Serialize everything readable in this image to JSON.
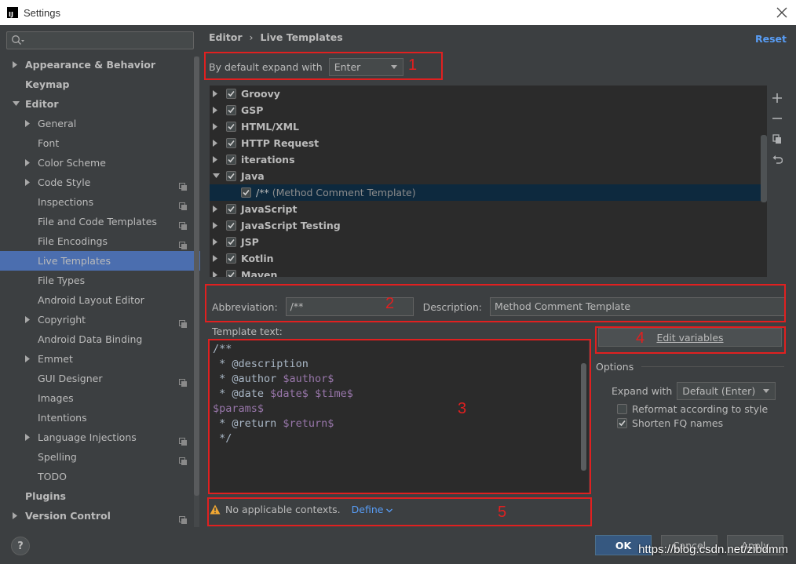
{
  "window": {
    "title": "Settings"
  },
  "search": {
    "placeholder": ""
  },
  "sidebar": {
    "items": [
      {
        "label": "Appearance & Behavior",
        "level": 0,
        "bold": true,
        "arrow": "right"
      },
      {
        "label": "Keymap",
        "level": 0,
        "bold": true
      },
      {
        "label": "Editor",
        "level": 0,
        "bold": true,
        "arrow": "down"
      },
      {
        "label": "General",
        "level": 1,
        "arrow": "right"
      },
      {
        "label": "Font",
        "level": 1
      },
      {
        "label": "Color Scheme",
        "level": 1,
        "arrow": "right"
      },
      {
        "label": "Code Style",
        "level": 1,
        "arrow": "right",
        "copy": true
      },
      {
        "label": "Inspections",
        "level": 1,
        "copy": true
      },
      {
        "label": "File and Code Templates",
        "level": 1,
        "copy": true
      },
      {
        "label": "File Encodings",
        "level": 1,
        "copy": true
      },
      {
        "label": "Live Templates",
        "level": 1,
        "selected": true
      },
      {
        "label": "File Types",
        "level": 1
      },
      {
        "label": "Android Layout Editor",
        "level": 1
      },
      {
        "label": "Copyright",
        "level": 1,
        "arrow": "right",
        "copy": true
      },
      {
        "label": "Android Data Binding",
        "level": 1
      },
      {
        "label": "Emmet",
        "level": 1,
        "arrow": "right"
      },
      {
        "label": "GUI Designer",
        "level": 1,
        "copy": true
      },
      {
        "label": "Images",
        "level": 1
      },
      {
        "label": "Intentions",
        "level": 1
      },
      {
        "label": "Language Injections",
        "level": 1,
        "arrow": "right",
        "copy": true
      },
      {
        "label": "Spelling",
        "level": 1,
        "copy": true
      },
      {
        "label": "TODO",
        "level": 1
      },
      {
        "label": "Plugins",
        "level": 0,
        "bold": true
      },
      {
        "label": "Version Control",
        "level": 0,
        "bold": true,
        "arrow": "right",
        "copy": true
      }
    ]
  },
  "breadcrumb": {
    "parent": "Editor",
    "separator": "›",
    "current": "Live Templates"
  },
  "reset_label": "Reset",
  "expand_default": {
    "label": "By default expand with",
    "value": "Enter"
  },
  "template_groups": [
    {
      "label": "Groovy",
      "checked": true,
      "arrow": "right"
    },
    {
      "label": "GSP",
      "checked": true,
      "arrow": "right"
    },
    {
      "label": "HTML/XML",
      "checked": true,
      "arrow": "right"
    },
    {
      "label": "HTTP Request",
      "checked": true,
      "arrow": "right"
    },
    {
      "label": "iterations",
      "checked": true,
      "arrow": "right"
    },
    {
      "label": "Java",
      "checked": true,
      "arrow": "down"
    },
    {
      "label": "/**",
      "desc": "(Method Comment Template)",
      "checked": true,
      "child": true,
      "selected": true
    },
    {
      "label": "JavaScript",
      "checked": true,
      "arrow": "right"
    },
    {
      "label": "JavaScript Testing",
      "checked": true,
      "arrow": "right"
    },
    {
      "label": "JSP",
      "checked": true,
      "arrow": "right"
    },
    {
      "label": "Kotlin",
      "checked": true,
      "arrow": "right"
    },
    {
      "label": "Maven",
      "checked": true,
      "arrow": "right"
    }
  ],
  "abbreviation": {
    "label": "Abbreviation:",
    "value": "/**"
  },
  "description": {
    "label": "Description:",
    "value": "Method Comment Template"
  },
  "template_text": {
    "label": "Template text:",
    "lines": [
      [
        {
          "t": "/**"
        }
      ],
      [
        {
          "t": " * @description"
        }
      ],
      [
        {
          "t": " * @author "
        },
        {
          "t": "$author$",
          "v": true
        }
      ],
      [
        {
          "t": " * @date "
        },
        {
          "t": "$date$",
          "v": true
        },
        {
          "t": " "
        },
        {
          "t": "$time$",
          "v": true
        }
      ],
      [
        {
          "t": "$params$",
          "v": true
        }
      ],
      [
        {
          "t": " * @return "
        },
        {
          "t": "$return$",
          "v": true
        }
      ],
      [
        {
          "t": " */"
        }
      ]
    ]
  },
  "contexts": {
    "message": "No applicable contexts.",
    "define_label": "Define"
  },
  "edit_variables_label": "Edit variables",
  "options": {
    "header": "Options",
    "expand_with": {
      "label": "Expand with",
      "value": "Default (Enter)"
    },
    "reformat": {
      "label": "Reformat according to style",
      "checked": false
    },
    "shorten": {
      "label": "Shorten FQ names",
      "checked": true
    }
  },
  "footer": {
    "help": "?",
    "ok": "OK",
    "cancel": "Cancel",
    "apply": "Apply",
    "watermark": "https://blog.csdn.net/zibdmm"
  },
  "annotations": [
    "1",
    "2",
    "3",
    "4",
    "5"
  ],
  "colors": {
    "annotation": "#e02020",
    "selection": "#4b6eaf",
    "link": "#589df6",
    "template_var": "#9876aa"
  }
}
